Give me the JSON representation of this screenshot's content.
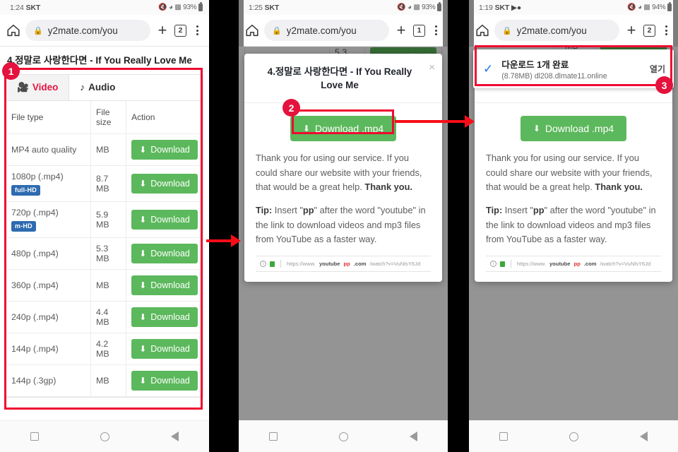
{
  "panels": [
    {
      "status": {
        "time": "1:24",
        "carrier": "SKT",
        "extra": "",
        "battery": "93%"
      },
      "toolbar": {
        "url": "y2mate.com/you",
        "tab_count": "2"
      }
    },
    {
      "status": {
        "time": "1:25",
        "carrier": "SKT",
        "extra": "",
        "battery": "93%"
      },
      "toolbar": {
        "url": "y2mate.com/you",
        "tab_count": "1"
      }
    },
    {
      "status": {
        "time": "1:19",
        "carrier": "SKT",
        "extra": "▶●",
        "battery": "94%"
      },
      "toolbar": {
        "url": "y2mate.com/you",
        "tab_count": "2"
      }
    }
  ],
  "page": {
    "video_title": "4.정말로 사랑한다면 - If You Really Love Me",
    "tabs": [
      {
        "label": "Video",
        "icon": "video-camera-icon",
        "active": true
      },
      {
        "label": "Audio",
        "icon": "music-note-icon",
        "active": false
      }
    ],
    "table": {
      "headers": [
        "File type",
        "File size",
        "Action"
      ],
      "download_label": "Download",
      "rows": [
        {
          "type": "MP4 auto quality",
          "badge": "",
          "size": "MB"
        },
        {
          "type": "1080p (.mp4)",
          "badge": "full-HD",
          "size": "8.7 MB"
        },
        {
          "type": "720p (.mp4)",
          "badge": "m-HD",
          "size": "5.9 MB"
        },
        {
          "type": "480p (.mp4)",
          "badge": "",
          "size": "5.3 MB"
        },
        {
          "type": "360p (.mp4)",
          "badge": "",
          "size": "MB"
        },
        {
          "type": "240p (.mp4)",
          "badge": "",
          "size": "4.4 MB"
        },
        {
          "type": "144p (.mp4)",
          "badge": "",
          "size": "4.2 MB"
        },
        {
          "type": "144p (.3gp)",
          "badge": "",
          "size": "MB"
        }
      ]
    }
  },
  "modal": {
    "title": "4.정말로 사랑한다면 - If You Really Love Me",
    "close": "×",
    "download_mp4": "Download .mp4",
    "thanks": "Thank you for using our service. If you could share our website with your friends, that would be a great help. ",
    "thanks_bold": "Thank you.",
    "tip_label": "Tip:",
    "tip_a": " Insert \"",
    "tip_pp": "pp",
    "tip_b": "\" after the word \"youtube\" in the link to download videos and mp3 files from YouTube as a faster way.",
    "urlshot": {
      "scheme": "https://www.",
      "bold": "youtube",
      "pp": "pp",
      "domain": ".com",
      "path": "/watch?v=VuNlsY6Jd"
    }
  },
  "notification": {
    "title": "다운로드 1개 완료",
    "subtitle": "(8.78MB) dl208.dlmate11.online",
    "action": "열기",
    "check": "✓"
  },
  "annotations": {
    "markers": [
      "1",
      "2",
      "3"
    ]
  },
  "colors": {
    "accent_red": "#ef0a30",
    "green": "#5cb85c",
    "blue_badge": "#2e6bb0",
    "tab_active": "#e4133f"
  }
}
